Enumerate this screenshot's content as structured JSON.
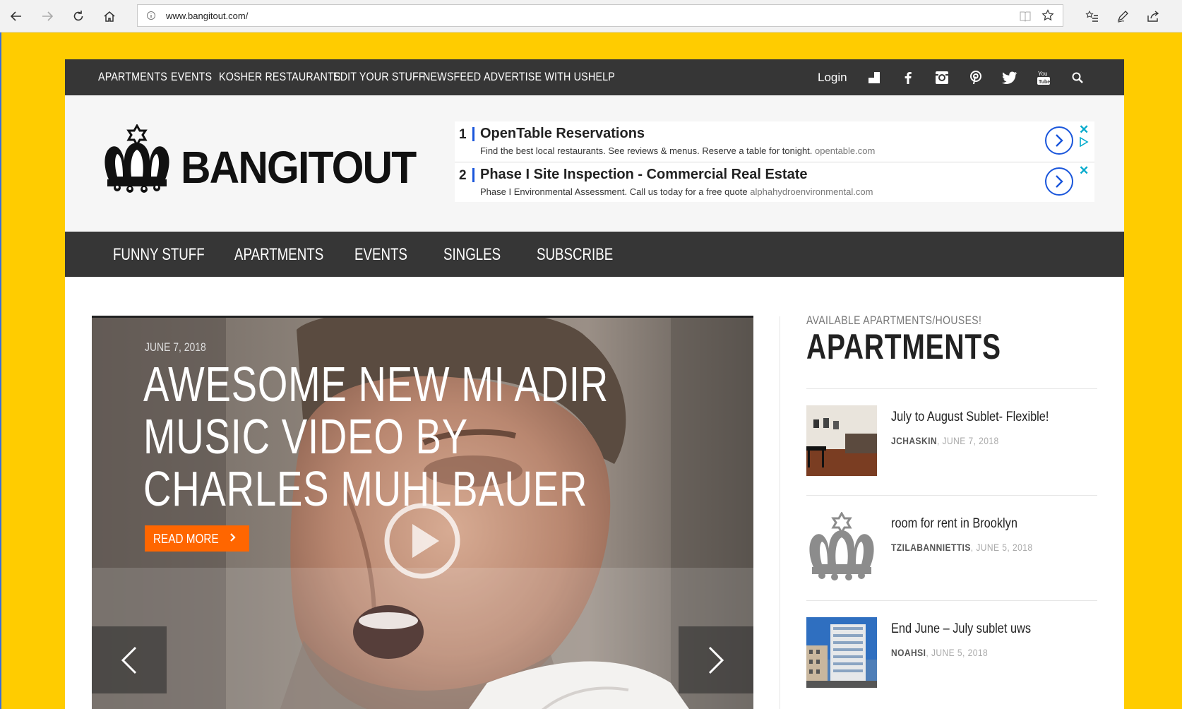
{
  "browser": {
    "url": "www.bangitout.com/"
  },
  "top_nav": {
    "links": [
      "APARTMENTS",
      "EVENTS",
      "KOSHER RESTAURANTS",
      "EDIT YOUR STUFF",
      "NEWSFEED",
      "ADVERTISE WITH US!",
      "HELP"
    ],
    "login": "Login"
  },
  "header": {
    "logo_text": "BANGITOUT"
  },
  "ads": [
    {
      "number": "1",
      "title": "OpenTable Reservations",
      "description": "Find the best local restaurants. See reviews & menus. Reserve a table for tonight.",
      "domain": "opentable.com"
    },
    {
      "number": "2",
      "title": "Phase I Site Inspection - Commercial Real Estate",
      "description": "Phase I Environmental Assessment. Call us today for a free quote",
      "domain": "alphahydroenvironmental.com"
    }
  ],
  "main_nav": {
    "links": [
      "FUNNY STUFF",
      "APARTMENTS",
      "EVENTS",
      "SINGLES",
      "SUBSCRIBE"
    ]
  },
  "slider": {
    "date": "JUNE 7, 2018",
    "title": "AWESOME NEW MI ADIR MUSIC VIDEO BY CHARLES MUHLBAUER",
    "read_more": "READ MORE"
  },
  "sidebar": {
    "eyebrow": "AVAILABLE APARTMENTS/HOUSES!",
    "heading": "APARTMENTS",
    "items": [
      {
        "title": "July to August Sublet- Flexible!",
        "author": "JCHASKIN",
        "date": "JUNE 7, 2018"
      },
      {
        "title": "room for rent in Brooklyn",
        "author": "TZILABANNIETTIS",
        "date": "JUNE 5, 2018"
      },
      {
        "title": "End June – July sublet uws",
        "author": "NOAHSI",
        "date": "JUNE 5, 2018"
      }
    ]
  },
  "colors": {
    "page_background": "#ffcc00",
    "nav_background": "#363636",
    "accent_orange": "#ff6600",
    "ad_blue": "#1a56db"
  }
}
